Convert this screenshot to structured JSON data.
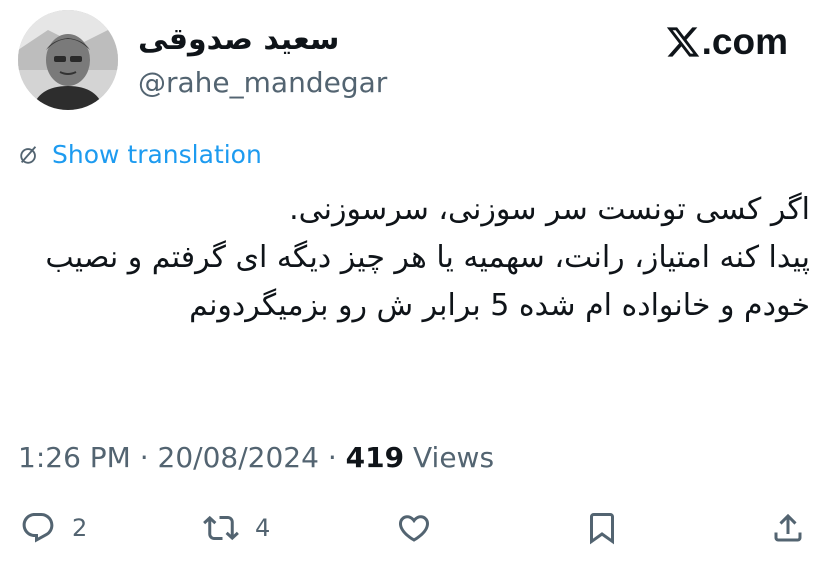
{
  "author": {
    "name": "سعید صدوقی",
    "handle": "@rahe_mandegar"
  },
  "brand": {
    "label": ".com",
    "icon": "x-logo-icon"
  },
  "translate": {
    "label": "Show translation",
    "icon": "translate-icon",
    "color": "#1d9bf0"
  },
  "tweet": {
    "text": "اگر کسی تونست سر سوزنی، سرسوزنی.\nپیدا کنه امتیاز، رانت، سهمیه یا هر چیز دیگه ای گرفتم و نصیب خودم و خانواده ام شده 5 برابر ش رو بزمیگردونم"
  },
  "meta": {
    "time": "1:26 PM",
    "date": "20/08/2024",
    "separator": "·",
    "views_count": "419",
    "views_label": "Views"
  },
  "actions": {
    "reply_count": "2",
    "retweet_count": "4",
    "reply_icon": "reply-icon",
    "retweet_icon": "retweet-icon",
    "like_icon": "heart-icon",
    "bookmark_icon": "bookmark-icon",
    "share_icon": "share-icon"
  }
}
